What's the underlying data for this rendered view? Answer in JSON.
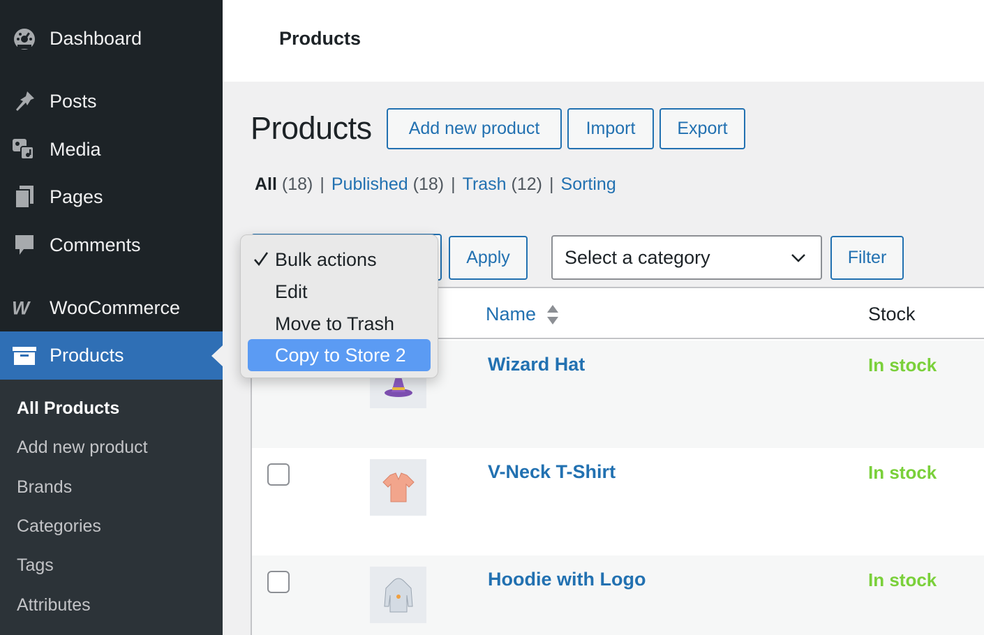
{
  "sidebar": {
    "items": [
      {
        "label": "Dashboard",
        "icon": "dashboard-icon"
      },
      {
        "label": "Posts",
        "icon": "pin-icon"
      },
      {
        "label": "Media",
        "icon": "media-icon"
      },
      {
        "label": "Pages",
        "icon": "pages-icon"
      },
      {
        "label": "Comments",
        "icon": "comment-icon"
      },
      {
        "label": "WooCommerce",
        "icon": "woocommerce-icon"
      },
      {
        "label": "Products",
        "icon": "archive-icon"
      }
    ],
    "submenu": [
      "All Products",
      "Add new product",
      "Brands",
      "Categories",
      "Tags",
      "Attributes"
    ]
  },
  "topbar": {
    "title": "Products"
  },
  "heading": {
    "title": "Products",
    "add_new": "Add new product",
    "import": "Import",
    "export": "Export"
  },
  "filters": {
    "all": "All",
    "all_count": "(18)",
    "published": "Published",
    "published_count": "(18)",
    "trash": "Trash",
    "trash_count": "(12)",
    "sorting": "Sorting",
    "sep": "|"
  },
  "bulk": {
    "apply": "Apply",
    "options": [
      "Bulk actions",
      "Edit",
      "Move to Trash",
      "Copy to Store 2"
    ],
    "selected": "Bulk actions",
    "highlighted": "Copy to Store 2"
  },
  "category_select": {
    "value": "Select a category",
    "filter": "Filter"
  },
  "table": {
    "columns": {
      "name": "Name",
      "stock": "Stock"
    },
    "rows": [
      {
        "name": "Wizard Hat",
        "stock": "In stock"
      },
      {
        "name": "V-Neck T-Shirt",
        "stock": "In stock"
      },
      {
        "name": "Hoodie with Logo",
        "stock": "In stock"
      }
    ]
  },
  "colors": {
    "sidebar_bg": "#1d2327",
    "accent": "#2271b1",
    "active_menu": "#2f6fb5",
    "in_stock": "#7ad03a",
    "dropdown_highlight": "#5b9bf3"
  }
}
